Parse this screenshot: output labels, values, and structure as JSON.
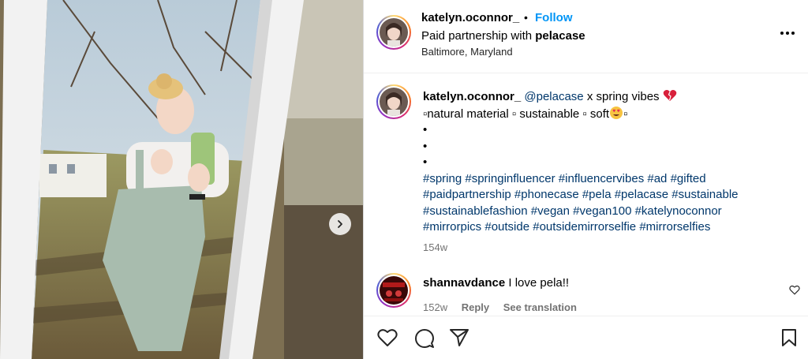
{
  "post": {
    "author": "katelyn.oconnor_",
    "separator": "•",
    "follow_label": "Follow",
    "paid_prefix": "Paid partnership with ",
    "partner": "pelacase",
    "location": "Baltimore, Maryland",
    "more_label": "•••"
  },
  "caption": {
    "author": "katelyn.oconnor_",
    "mention": "@pelacase",
    "line1_rest": " x spring vibes ",
    "line2": "▫natural material ▫ sustainable ▫ soft",
    "line2_end": "▫",
    "bullets": [
      "•",
      "•",
      "•"
    ],
    "hashtags_line1": [
      "#spring",
      "#springinfluencer",
      "#influencervibes",
      "#ad",
      "#gifted"
    ],
    "hashtags_line2": [
      "#paidpartnership",
      "#phonecase",
      "#pela",
      "#pelacase",
      "#sustainable"
    ],
    "hashtags_line3": [
      "#sustainablefashion",
      "#vegan",
      "#vegan100",
      "#katelynoconnor"
    ],
    "hashtags_line4": [
      "#mirrorpics",
      "#outside",
      "#outsidemirrorselfie",
      "#mirrorselfies"
    ],
    "time": "154w"
  },
  "comment": {
    "author": "shannavdance",
    "text": " I love pela!!",
    "time": "152w",
    "reply_label": "Reply",
    "translate_label": "See translation"
  },
  "icons": {
    "like": "heart-icon",
    "comment": "comment-icon",
    "share": "share-icon",
    "save": "bookmark-icon",
    "next": "chevron-right-icon",
    "caption_emoji_1": "broken-heart-emoji",
    "caption_emoji_2": "heart-eyes-emoji"
  },
  "colors": {
    "link": "#00376b",
    "follow": "#0095f6",
    "muted": "#737373"
  }
}
